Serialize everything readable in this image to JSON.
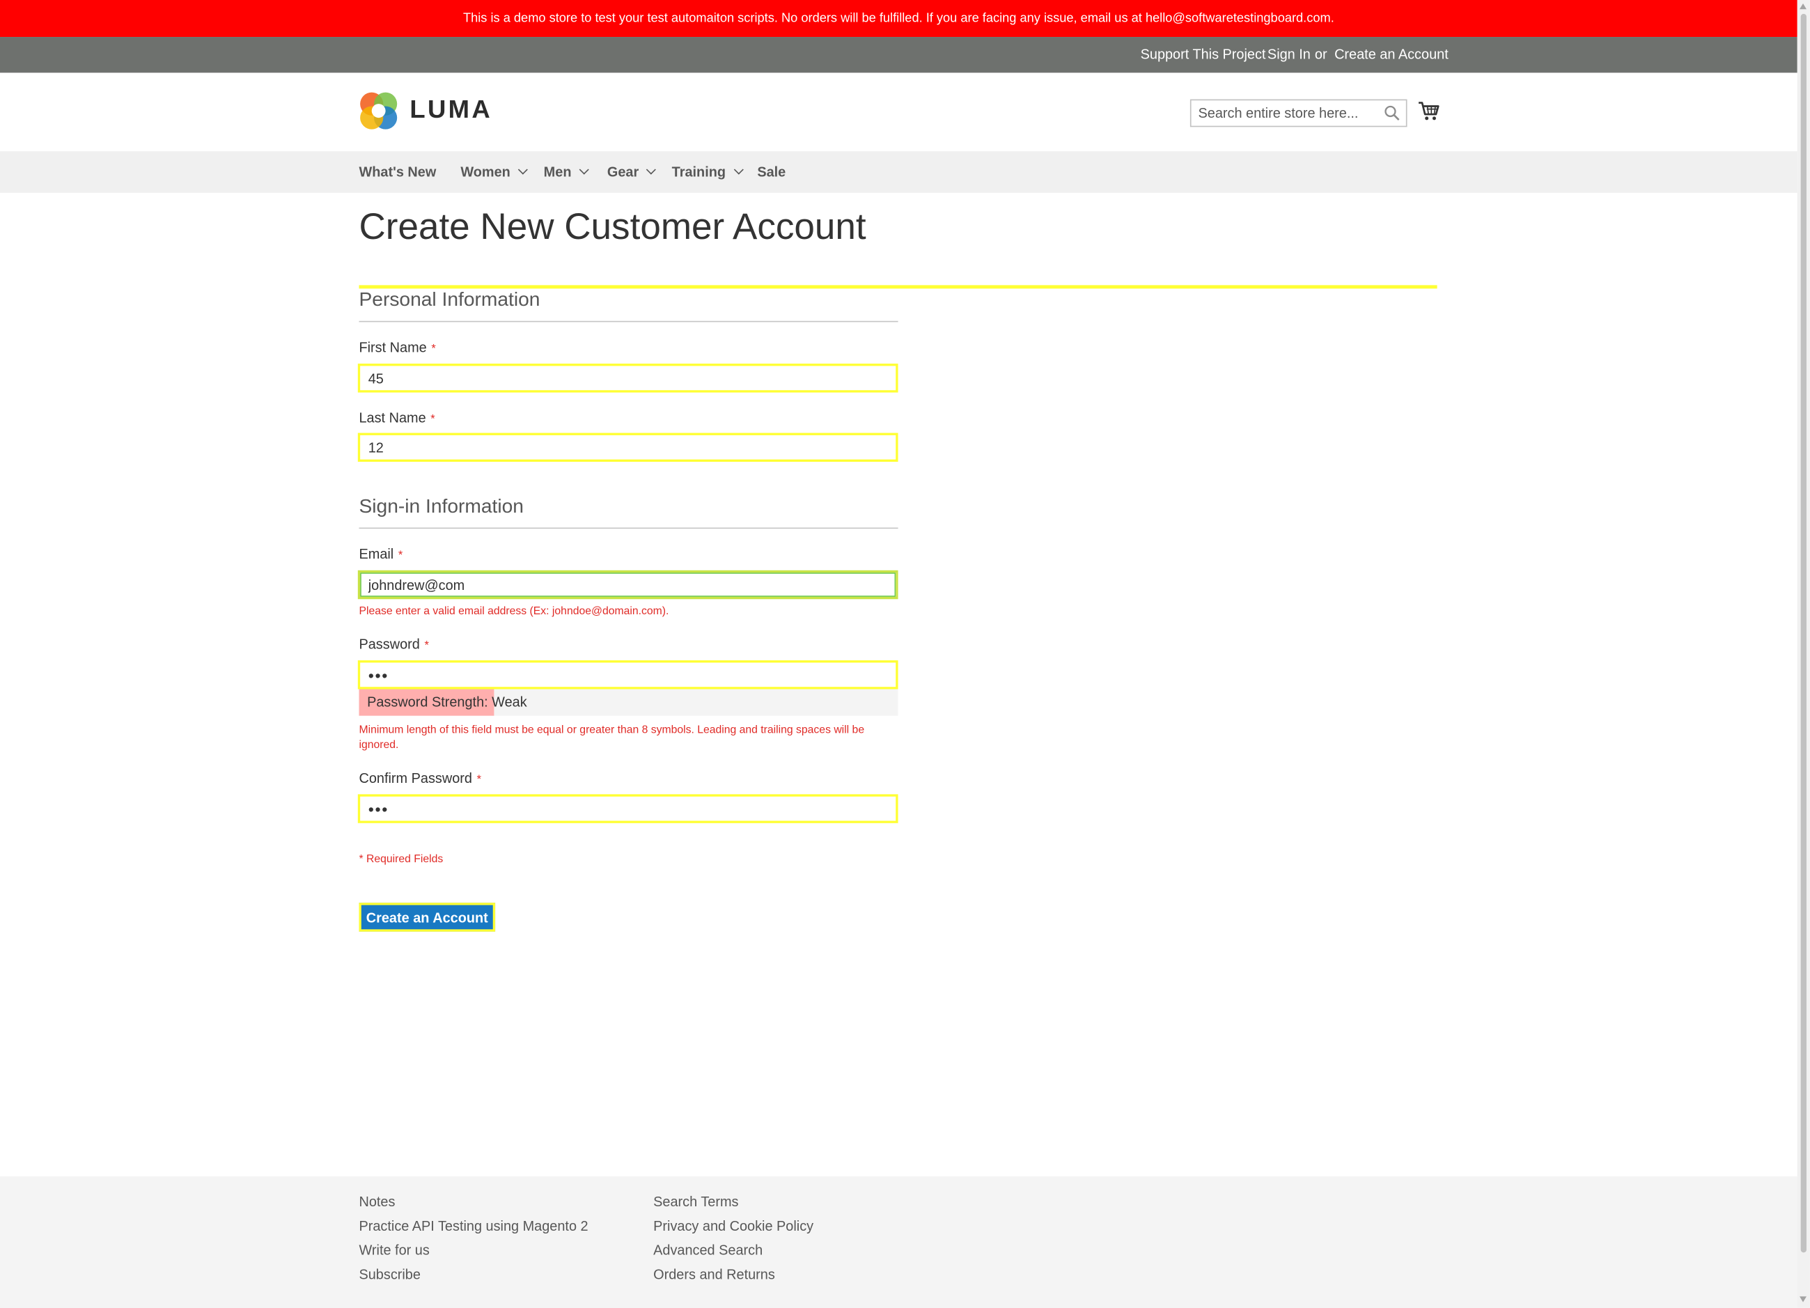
{
  "demo_banner": {
    "text": "This is a demo store to test your test automaiton scripts. No orders will be fulfilled. If you are facing any issue, email us at hello@softwaretestingboard.com."
  },
  "header_links": {
    "support": "Support This Project",
    "sign_in": "Sign In",
    "or": "or",
    "create_account": "Create an Account"
  },
  "logo": {
    "text": "LUMA"
  },
  "search": {
    "placeholder": "Search entire store here...",
    "value": ""
  },
  "nav": {
    "items": [
      {
        "label": "What's New"
      },
      {
        "label": "Women"
      },
      {
        "label": "Men"
      },
      {
        "label": "Gear"
      },
      {
        "label": "Training"
      },
      {
        "label": "Sale"
      }
    ]
  },
  "page": {
    "title": "Create New Customer Account"
  },
  "personal_info": {
    "title": "Personal Information",
    "first_name": {
      "label": "First Name",
      "required_mark": "*",
      "value": "45"
    },
    "last_name": {
      "label": "Last Name",
      "required_mark": "*",
      "value": "12"
    }
  },
  "signin_info": {
    "title": "Sign-in Information",
    "email": {
      "label": "Email",
      "required_mark": "*",
      "value": "johndrew@com",
      "error": "Please enter a valid email address (Ex: johndoe@domain.com)."
    },
    "password": {
      "label": "Password",
      "required_mark": "*",
      "value": "•••",
      "strength_label": "Password Strength: Weak",
      "strength_fraction": 0.25,
      "error": "Minimum length of this field must be equal or greater than 8 symbols. Leading and trailing spaces will be ignored."
    },
    "confirm_password": {
      "label": "Confirm Password",
      "required_mark": "*",
      "value": "•••"
    }
  },
  "required_note": "* Required Fields",
  "submit_label": "Create an Account",
  "footer": {
    "col1": [
      "Notes",
      "Practice API Testing using Magento 2",
      "Write for us",
      "Subscribe"
    ],
    "col2": [
      "Search Terms",
      "Privacy and Cookie Policy",
      "Advanced Search",
      "Orders and Returns"
    ]
  },
  "colors": {
    "banner": "#ff0000",
    "header_panel": "#6e716e",
    "accent_highlight": "#ffff33",
    "primary_button": "#1979c3",
    "error": "#e02b27",
    "strength_weak": "#ffafae"
  },
  "icons": {
    "search": "search-icon",
    "cart": "cart-icon",
    "logo": "luma-logo-icon"
  }
}
